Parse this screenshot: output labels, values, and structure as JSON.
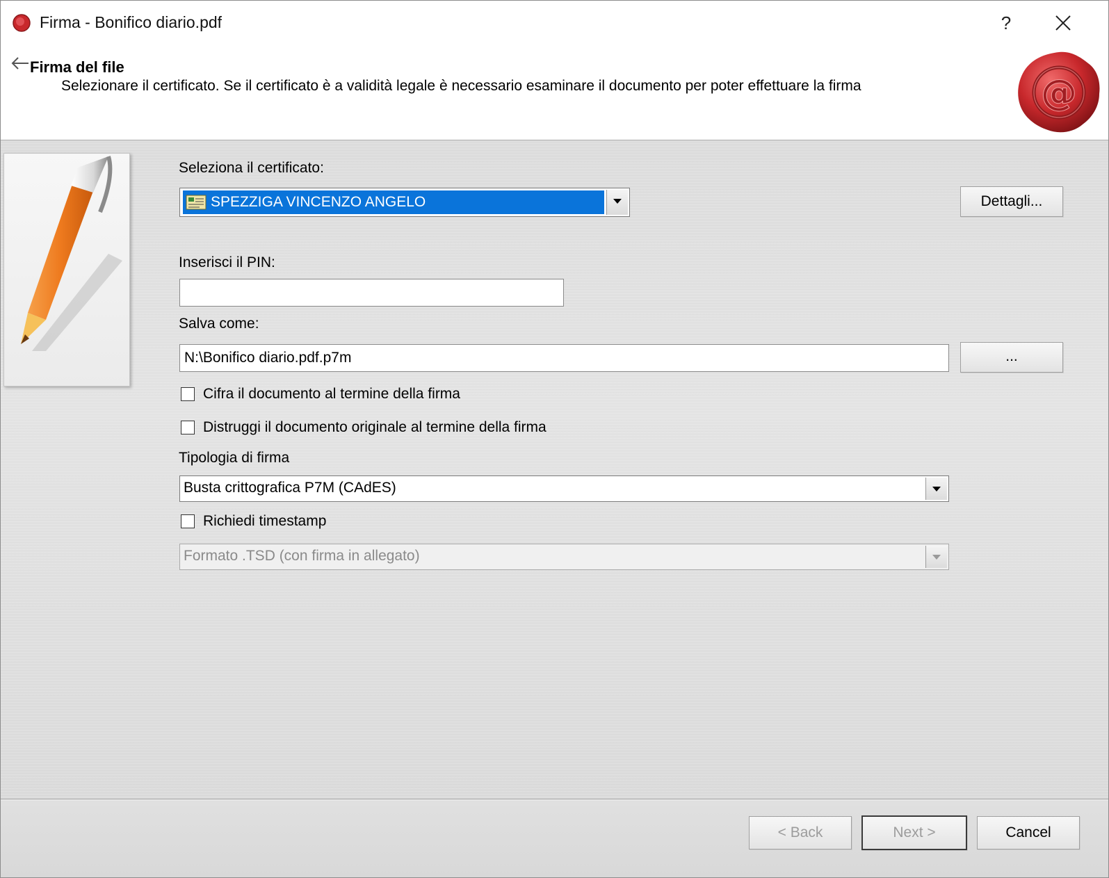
{
  "window": {
    "title": "Firma - Bonifico diario.pdf",
    "help_label": "?"
  },
  "header": {
    "title": "Firma del file",
    "subtitle": "Selezionare il certificato. Se il certificato è a validità legale è necessario esaminare il documento per poter effettuare la firma"
  },
  "form": {
    "certificate_label": "Seleziona il certificato:",
    "certificate_value": "SPEZZIGA VINCENZO ANGELO",
    "details_button": "Dettagli...",
    "pin_label": "Inserisci il PIN:",
    "pin_value": "",
    "save_as_label": "Salva come:",
    "save_as_value": "N:\\Bonifico diario.pdf.p7m",
    "browse_button": "...",
    "encrypt_checkbox_label": "Cifra il documento al termine della firma",
    "encrypt_checked": false,
    "destroy_checkbox_label": "Distruggi il documento originale al termine della firma",
    "destroy_checked": false,
    "signature_type_label": "Tipologia di firma",
    "signature_type_value": "Busta crittografica P7M (CAdES)",
    "timestamp_checkbox_label": "Richiedi timestamp",
    "timestamp_checked": false,
    "timestamp_format_value": "Formato .TSD (con firma in allegato)"
  },
  "footer": {
    "back_button": "< Back",
    "next_button": "Next >",
    "cancel_button": "Cancel"
  },
  "colors": {
    "selection_blue": "#0a74da",
    "seal_red": "#c8282c"
  }
}
